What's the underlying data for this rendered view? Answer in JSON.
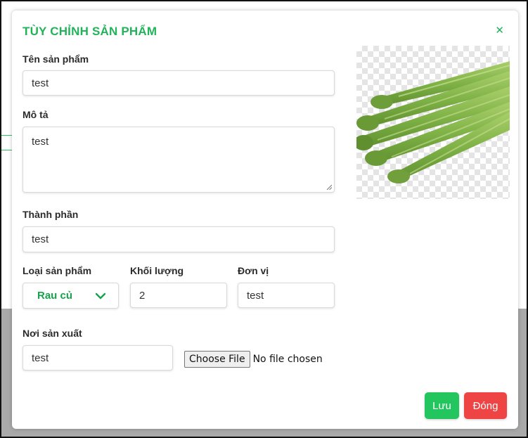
{
  "modal": {
    "title": "TÙY CHỈNH SẢN PHẨM",
    "close_icon": "close-icon"
  },
  "form": {
    "name_label": "Tên sản phẩm",
    "name_value": "test",
    "description_label": "Mô tả",
    "description_value": "test",
    "ingredients_label": "Thành phần",
    "ingredients_value": "test",
    "category_label": "Loại sản phẩm",
    "category_value": "Rau củ",
    "weight_label": "Khối lượng",
    "weight_value": "2",
    "unit_label": "Đơn vị",
    "unit_value": "test",
    "origin_label": "Nơi sản xuất",
    "origin_value": "test",
    "file_button_label": "Choose File",
    "file_status": "No file chosen"
  },
  "actions": {
    "save_label": "Lưu",
    "close_label": "Đóng"
  },
  "colors": {
    "accent": "#22b35a",
    "save": "#22c55e",
    "close": "#ef4444"
  },
  "image": {
    "subject": "asparagus-image"
  }
}
